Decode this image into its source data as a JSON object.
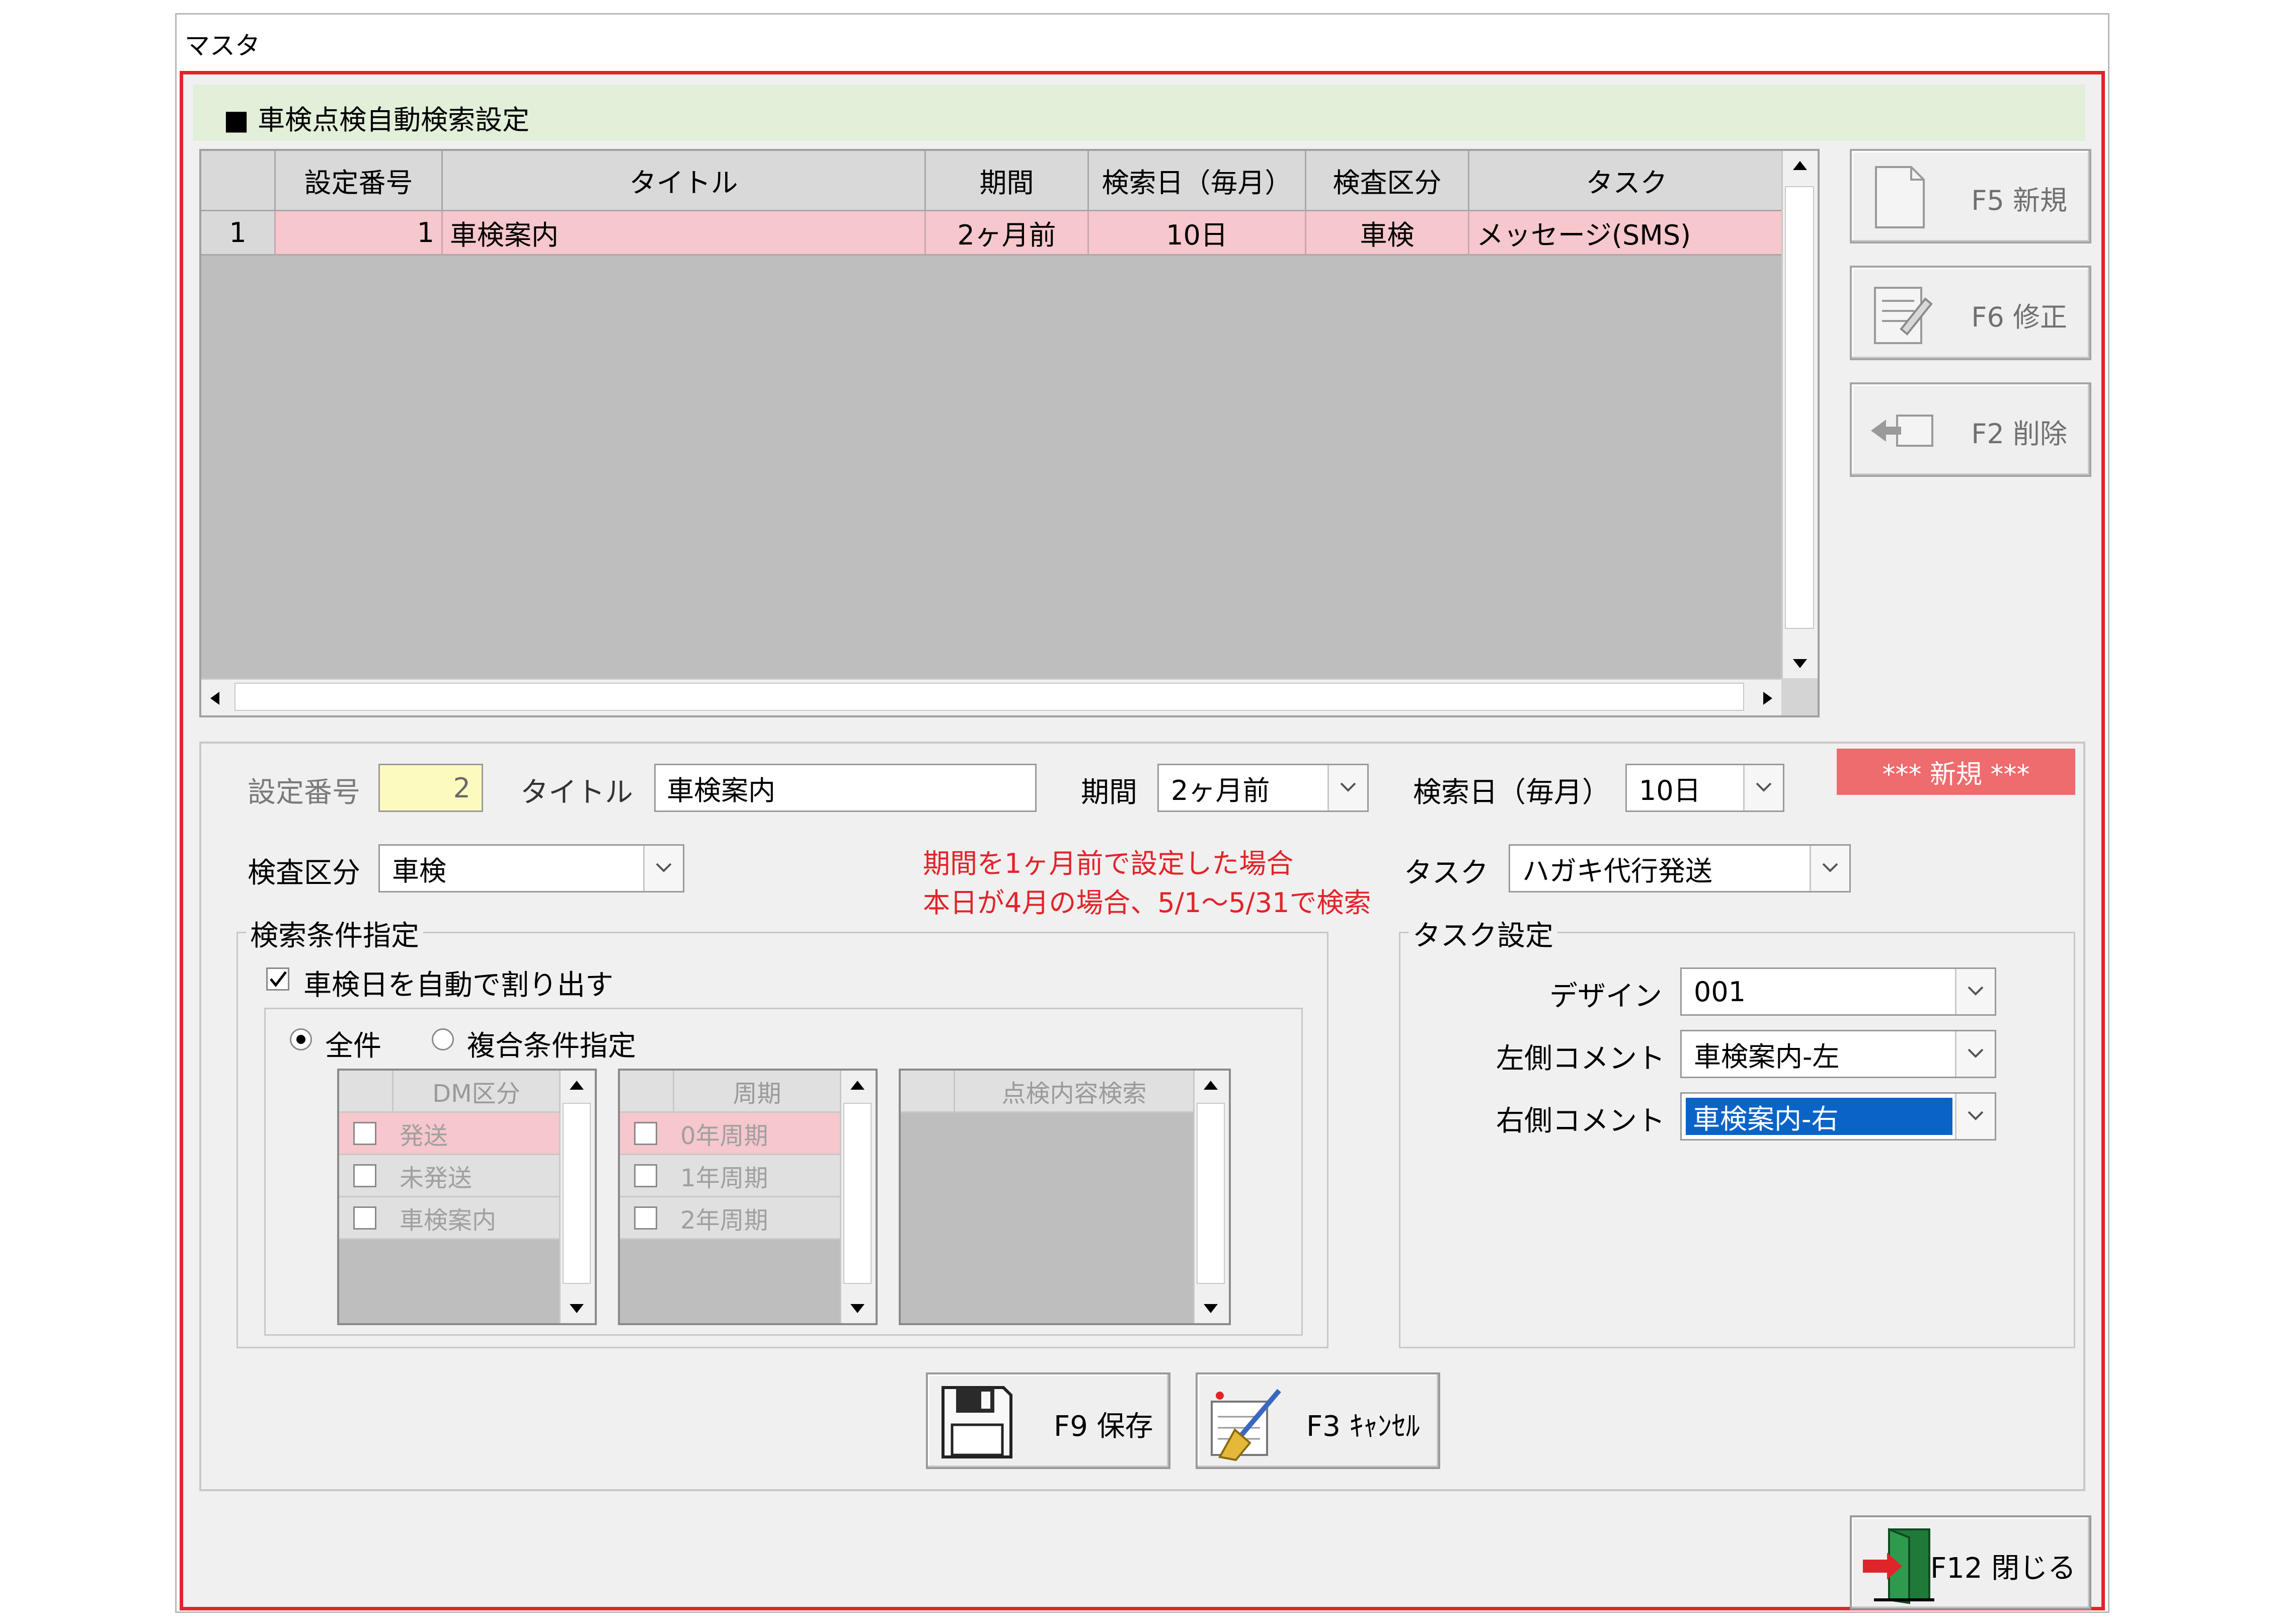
{
  "window": {
    "title": "マスタ"
  },
  "section": {
    "title": "■ 車検点検自動検索設定"
  },
  "grid": {
    "columns": [
      "",
      "設定番号",
      "タイトル",
      "期間",
      "検索日（毎月）",
      "検査区分",
      "タスク"
    ],
    "rows": [
      {
        "index": "1",
        "no": "1",
        "title": "車検案内",
        "period": "2ヶ月前",
        "day": "10日",
        "category": "車検",
        "task": "メッセージ(SMS)"
      }
    ]
  },
  "sidebar": {
    "new_label": "F5 新規",
    "edit_label": "F6 修正",
    "delete_label": "F2 削除"
  },
  "form": {
    "mode_badge": "*** 新規 ***",
    "setting_no_label": "設定番号",
    "setting_no_value": "2",
    "title_label": "タイトル",
    "title_value": "車検案内",
    "period_label": "期間",
    "period_value": "2ヶ月前",
    "search_day_label": "検索日（毎月）",
    "search_day_value": "10日",
    "category_label": "検査区分",
    "category_value": "車検",
    "note_line1": "期間を1ヶ月前で設定した場合",
    "note_line2": "本日が4月の場合、5/1～5/31で検索",
    "task_label": "タスク",
    "task_value": "ハガキ代行発送"
  },
  "search_conditions": {
    "group_title": "検索条件指定",
    "auto_calc_label": "車検日を自動で割り出す",
    "auto_calc_checked": true,
    "radio_all": "全件",
    "radio_compound": "複合条件指定",
    "dm_list": {
      "header": "DM区分",
      "items": [
        "発送",
        "未発送",
        "車検案内"
      ]
    },
    "cycle_list": {
      "header": "周期",
      "items": [
        "0年周期",
        "1年周期",
        "2年周期"
      ]
    },
    "inspect_list": {
      "header": "点検内容検索"
    }
  },
  "task_settings": {
    "group_title": "タスク設定",
    "design_label": "デザイン",
    "design_value": "001",
    "left_comment_label": "左側コメント",
    "left_comment_value": "車検案内-左",
    "right_comment_label": "右側コメント",
    "right_comment_value": "車検案内-右"
  },
  "buttons": {
    "save_label": "F9 保存",
    "cancel_label": "F3 ｷｬﾝｾﾙ",
    "close_label": "F12 閉じる"
  },
  "colors": {
    "frame": "#e1242a",
    "section_bg": "#e2efd9",
    "selected_row": "#f6c7cc",
    "badge": "#ee6b6e",
    "highlight": "#0a64c8"
  }
}
